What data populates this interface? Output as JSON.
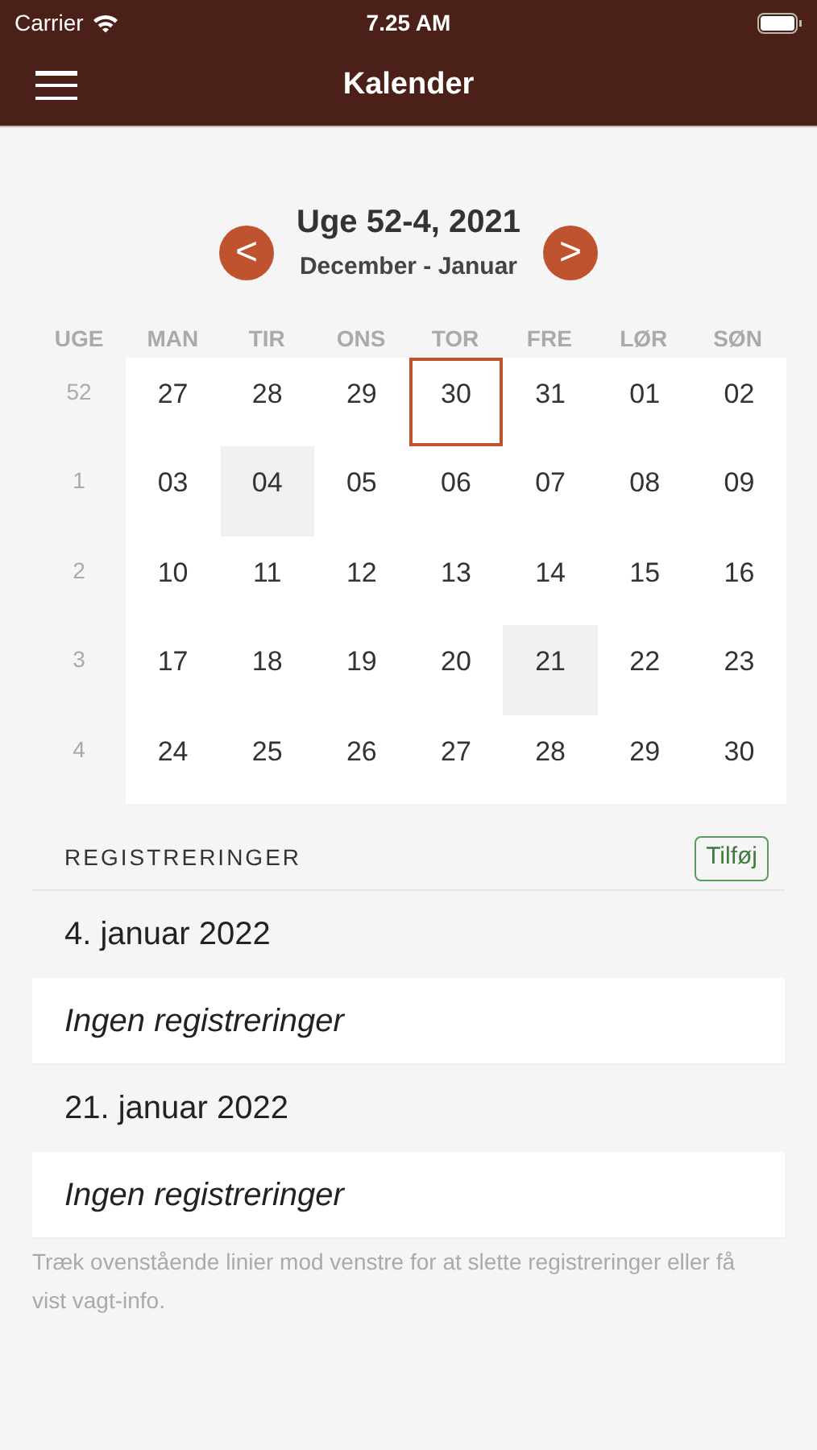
{
  "status_bar": {
    "carrier": "Carrier",
    "time": "7.25 AM"
  },
  "nav_bar": {
    "title": "Kalender"
  },
  "period": {
    "title": "Uge 52-4, 2021",
    "subtitle": "December - Januar",
    "prev": "<",
    "next": ">"
  },
  "calendar": {
    "week_header": "UGE",
    "day_headers": [
      "MAN",
      "TIR",
      "ONS",
      "TOR",
      "FRE",
      "LØR",
      "SØN"
    ],
    "weeks": [
      {
        "week": "52",
        "days": [
          {
            "day": "27",
            "today": false,
            "highlighted": false
          },
          {
            "day": "28",
            "today": false,
            "highlighted": false
          },
          {
            "day": "29",
            "today": false,
            "highlighted": false
          },
          {
            "day": "30",
            "today": true,
            "highlighted": false
          },
          {
            "day": "31",
            "today": false,
            "highlighted": false
          },
          {
            "day": "01",
            "today": false,
            "highlighted": false
          },
          {
            "day": "02",
            "today": false,
            "highlighted": false
          }
        ]
      },
      {
        "week": "1",
        "days": [
          {
            "day": "03",
            "today": false,
            "highlighted": false
          },
          {
            "day": "04",
            "today": false,
            "highlighted": true
          },
          {
            "day": "05",
            "today": false,
            "highlighted": false
          },
          {
            "day": "06",
            "today": false,
            "highlighted": false
          },
          {
            "day": "07",
            "today": false,
            "highlighted": false
          },
          {
            "day": "08",
            "today": false,
            "highlighted": false
          },
          {
            "day": "09",
            "today": false,
            "highlighted": false
          }
        ]
      },
      {
        "week": "2",
        "days": [
          {
            "day": "10",
            "today": false,
            "highlighted": false
          },
          {
            "day": "11",
            "today": false,
            "highlighted": false
          },
          {
            "day": "12",
            "today": false,
            "highlighted": false
          },
          {
            "day": "13",
            "today": false,
            "highlighted": false
          },
          {
            "day": "14",
            "today": false,
            "highlighted": false
          },
          {
            "day": "15",
            "today": false,
            "highlighted": false
          },
          {
            "day": "16",
            "today": false,
            "highlighted": false
          }
        ]
      },
      {
        "week": "3",
        "days": [
          {
            "day": "17",
            "today": false,
            "highlighted": false
          },
          {
            "day": "18",
            "today": false,
            "highlighted": false
          },
          {
            "day": "19",
            "today": false,
            "highlighted": false
          },
          {
            "day": "20",
            "today": false,
            "highlighted": false
          },
          {
            "day": "21",
            "today": false,
            "highlighted": true
          },
          {
            "day": "22",
            "today": false,
            "highlighted": false
          },
          {
            "day": "23",
            "today": false,
            "highlighted": false
          }
        ]
      },
      {
        "week": "4",
        "days": [
          {
            "day": "24",
            "today": false,
            "highlighted": false
          },
          {
            "day": "25",
            "today": false,
            "highlighted": false
          },
          {
            "day": "26",
            "today": false,
            "highlighted": false
          },
          {
            "day": "27",
            "today": false,
            "highlighted": false
          },
          {
            "day": "28",
            "today": false,
            "highlighted": false
          },
          {
            "day": "29",
            "today": false,
            "highlighted": false
          },
          {
            "day": "30",
            "today": false,
            "highlighted": false
          }
        ]
      }
    ]
  },
  "registrations": {
    "title": "REGISTRERINGER",
    "add_button": "Tilføj",
    "groups": [
      {
        "date": "4. januar 2022",
        "entries": [
          "Ingen registreringer"
        ]
      },
      {
        "date": "21. januar 2022",
        "entries": [
          "Ingen registreringer"
        ]
      }
    ],
    "footer": "Træk ovenstående linier mod venstre for at slette registreringer eller få vist vagt-info."
  }
}
